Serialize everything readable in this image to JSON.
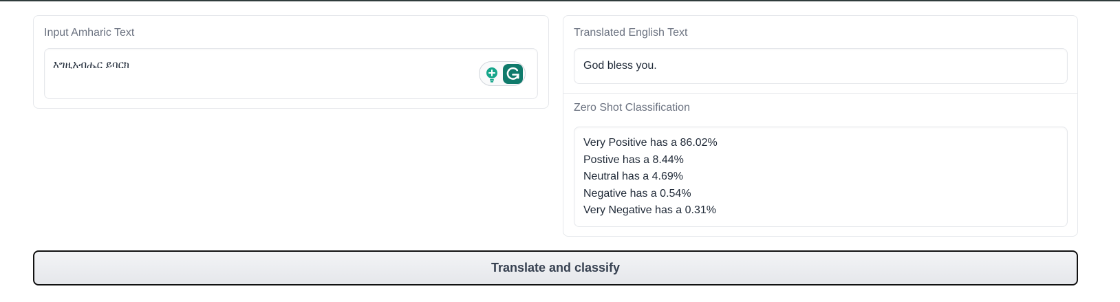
{
  "input_panel": {
    "label": "Input Amharic Text",
    "value": "እግዚአብሔር ይባርክ"
  },
  "output_panel": {
    "translation_label": "Translated English Text",
    "translation_value": "God bless you.",
    "classification_label": "Zero Shot Classification",
    "classification_lines": [
      "Very Positive has a 86.02%",
      "Postive has a 8.44%",
      "Neutral has a 4.69%",
      "Negative has a 0.54%",
      "Very Negative has a 0.31%"
    ]
  },
  "submit_button": {
    "label": "Translate and classify"
  },
  "icons": {
    "grammarly_bulb": "lightbulb-icon",
    "grammarly_logo": "grammarly-g-icon"
  },
  "colors": {
    "grammarly_green": "#15a58a",
    "grammarly_dark": "#0f7a6b",
    "button_border": "#111111"
  }
}
